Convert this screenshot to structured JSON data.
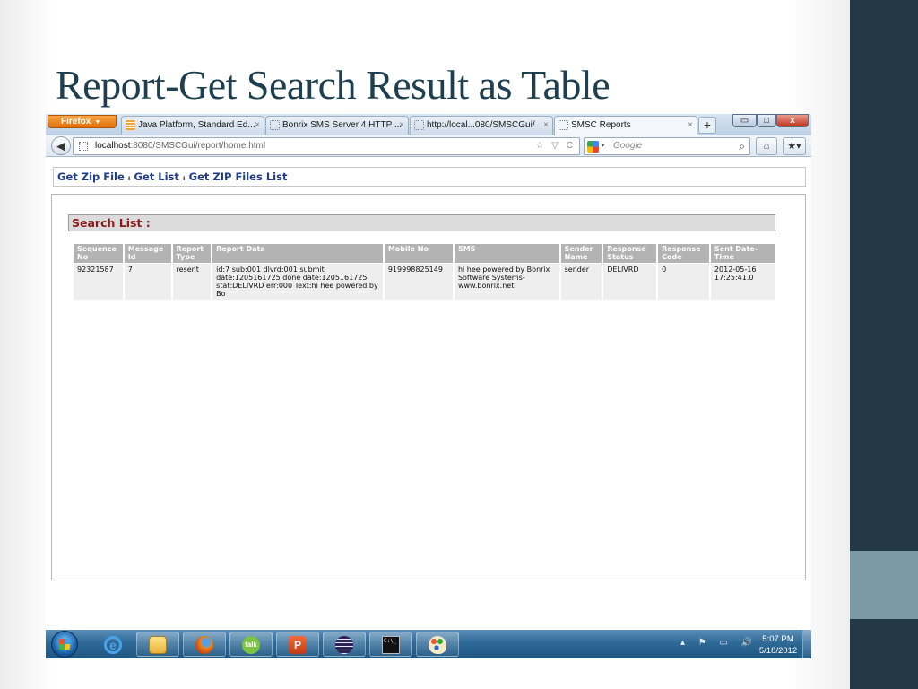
{
  "slide": {
    "title": "Report-Get Search Result as Table"
  },
  "browser": {
    "menu_button": "Firefox",
    "tabs": [
      {
        "label": "Java Platform, Standard Ed...",
        "close": "×",
        "icon": "java-icon"
      },
      {
        "label": "Bonrix SMS Server 4 HTTP ...",
        "close": "×",
        "icon": "page-icon"
      },
      {
        "label": "http://local...080/SMSCGui/",
        "close": "×",
        "icon": "page-icon"
      },
      {
        "label": "SMSC Reports",
        "close": "×",
        "icon": "page-icon",
        "active": true
      }
    ],
    "new_tab": "+",
    "window_buttons": {
      "minimize": "▭",
      "maximize": "□",
      "close": "x"
    },
    "url_host": "localhost",
    "url_rest": ":8080/SMSCGui/report/home.html",
    "url_tools": "☆ ▽ C",
    "search_engine_caret": "▾",
    "search_placeholder": "Google",
    "search_icon": "⌕",
    "home_icon": "⌂",
    "bookmarks_icon": "★▾"
  },
  "page": {
    "links": [
      "Get Zip File",
      "Get List",
      "Get ZIP Files List"
    ],
    "link_separator": "ı",
    "search_header": "Search List :",
    "table": {
      "columns": [
        "Sequence No",
        "Message Id",
        "Report Type",
        "Report Data",
        "Mobile No",
        "SMS",
        "Sender Name",
        "Response Status",
        "Response Code",
        "Sent Date-Time"
      ],
      "rows": [
        [
          "92321587",
          "7",
          "resent",
          "id:7 sub:001 dlvrd:001 submit date:1205161725 done date:1205161725 stat:DELIVRD err:000 Text:hi hee powered by Bo",
          "919998825149",
          "hi hee powered by Bonrix Software Systems-www.bonrix.net",
          "sender",
          "DELIVRD",
          "0",
          "2012-05-16 17:25:41.0"
        ]
      ]
    }
  },
  "taskbar": {
    "apps": [
      "start-button",
      "internet-explorer",
      "file-explorer",
      "firefox",
      "google-talk",
      "powerpoint",
      "eclipse",
      "command-prompt",
      "paint"
    ],
    "talk_label": "talk",
    "cmd_label": "C:\\_",
    "tray_icons": "▴ ⚑ ▭ 🔊",
    "time": "5:07 PM",
    "date": "5/18/2012"
  },
  "colors": {
    "title": "#1e3f4f",
    "side_dark": "#233845",
    "side_accent": "#7a9aa6",
    "link": "#1f3c86",
    "search_header_text": "#8a1a1a"
  }
}
